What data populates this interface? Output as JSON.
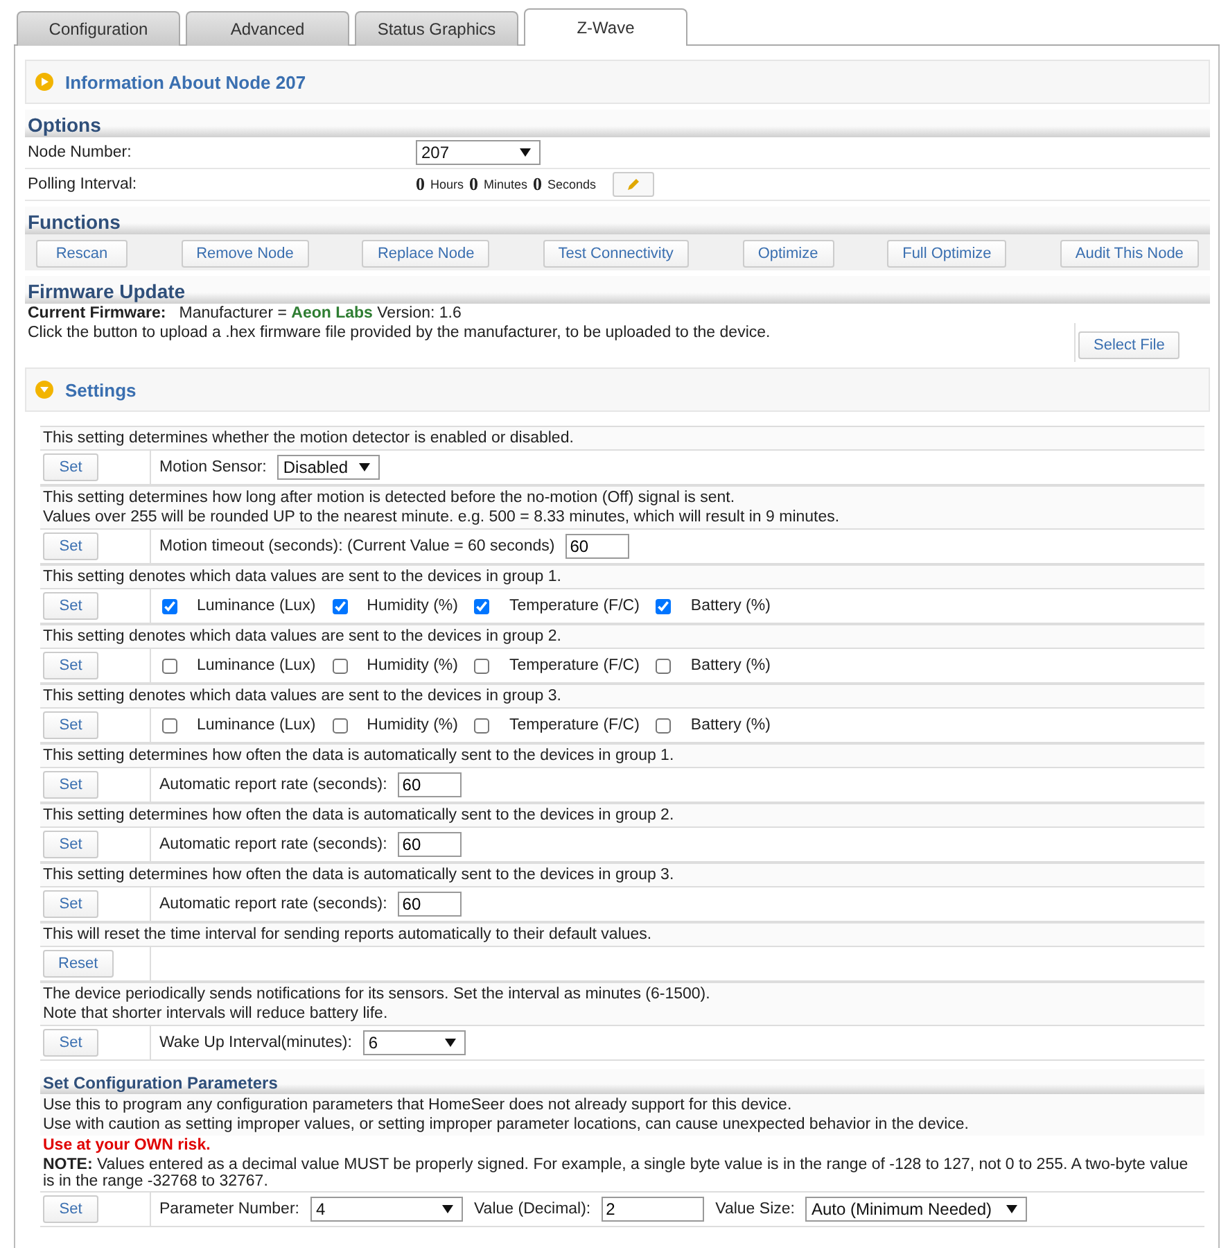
{
  "tabs": [
    {
      "label": "Configuration",
      "selected": false
    },
    {
      "label": "Advanced",
      "selected": false
    },
    {
      "label": "Status Graphics",
      "selected": false
    },
    {
      "label": "Z-Wave",
      "selected": true
    }
  ],
  "info_header": "Information About Node 207",
  "options": {
    "title": "Options",
    "node_label": "Node Number:",
    "node_value": "207",
    "polling_label": "Polling Interval:",
    "polling": [
      {
        "value": "0",
        "unit": "Hours"
      },
      {
        "value": "0",
        "unit": "Minutes"
      },
      {
        "value": "0",
        "unit": "Seconds"
      }
    ]
  },
  "functions": {
    "title": "Functions",
    "buttons": [
      "Rescan",
      "Remove Node",
      "Replace Node",
      "Test Connectivity",
      "Optimize",
      "Full Optimize",
      "Audit This Node"
    ]
  },
  "firmware": {
    "title": "Firmware Update",
    "current_label": "Current Firmware:",
    "current_text": "Manufacturer = **Aeon Labs** Version: 1.6",
    "hint": "Click the button to upload a .hex firmware file provided by the manufacturer, to be uploaded to the device.",
    "button": "Select File"
  },
  "settings": {
    "title": "Settings",
    "items": [
      {
        "description": [
          "This setting determines whether the motion detector is enabled or disabled."
        ],
        "button": "Set",
        "controls": [
          {
            "kind": "select",
            "label": "Motion Sensor:",
            "value": "Disabled"
          }
        ]
      },
      {
        "description": [
          "This setting determines how long after motion is detected before the no-motion (Off) signal is sent.",
          "Values over 255 will be rounded UP to the nearest minute. e.g. 500 = 8.33 minutes, which will result in 9 minutes."
        ],
        "button": "Set",
        "controls": [
          {
            "kind": "input",
            "label": "Motion timeout (seconds): (Current Value = 60 seconds)",
            "value": "60"
          }
        ]
      },
      {
        "description": [
          "This setting denotes which data values are sent to the devices in group 1."
        ],
        "button": "Set",
        "controls": [
          {
            "kind": "check",
            "label": "Luminance (Lux)",
            "checked": true
          },
          {
            "kind": "check",
            "label": "Humidity (%)",
            "checked": true
          },
          {
            "kind": "check",
            "label": "Temperature (F/C)",
            "checked": true
          },
          {
            "kind": "check",
            "label": "Battery (%)",
            "checked": true
          }
        ]
      },
      {
        "description": [
          "This setting denotes which data values are sent to the devices in group 2."
        ],
        "button": "Set",
        "controls": [
          {
            "kind": "check",
            "label": "Luminance (Lux)",
            "checked": false
          },
          {
            "kind": "check",
            "label": "Humidity (%)",
            "checked": false
          },
          {
            "kind": "check",
            "label": "Temperature (F/C)",
            "checked": false
          },
          {
            "kind": "check",
            "label": "Battery (%)",
            "checked": false
          }
        ]
      },
      {
        "description": [
          "This setting denotes which data values are sent to the devices in group 3."
        ],
        "button": "Set",
        "controls": [
          {
            "kind": "check",
            "label": "Luminance (Lux)",
            "checked": false
          },
          {
            "kind": "check",
            "label": "Humidity (%)",
            "checked": false
          },
          {
            "kind": "check",
            "label": "Temperature (F/C)",
            "checked": false
          },
          {
            "kind": "check",
            "label": "Battery (%)",
            "checked": false
          }
        ]
      },
      {
        "description": [
          "This setting determines how often the data is automatically sent to the devices in group 1."
        ],
        "button": "Set",
        "controls": [
          {
            "kind": "input",
            "label": "Automatic report rate (seconds):",
            "value": "60"
          }
        ]
      },
      {
        "description": [
          "This setting determines how often the data is automatically sent to the devices in group 2."
        ],
        "button": "Set",
        "controls": [
          {
            "kind": "input",
            "label": "Automatic report rate (seconds):",
            "value": "60"
          }
        ]
      },
      {
        "description": [
          "This setting determines how often the data is automatically sent to the devices in group 3."
        ],
        "button": "Set",
        "controls": [
          {
            "kind": "input",
            "label": "Automatic report rate (seconds):",
            "value": "60"
          }
        ]
      },
      {
        "description": [
          "This will reset the time interval for sending reports automatically to their default values."
        ],
        "button": "Reset"
      },
      {
        "description": [
          "The device periodically sends notifications for its sensors. Set the interval as minutes (6-1500).",
          "Note that shorter intervals will reduce battery life."
        ],
        "button": "Set",
        "controls": [
          {
            "kind": "select",
            "label": "Wake Up Interval(minutes):",
            "value": "6"
          }
        ]
      }
    ]
  },
  "config": {
    "title": "Set Configuration Parameters",
    "lines": [
      "Use this to program any configuration parameters that HomeSeer does not already support for this device.",
      "Use with caution as setting improper values, or setting improper parameter locations, can cause unexpected behavior in the device."
    ],
    "warning": "Use at your OWN risk.",
    "note": "**NOTE:** Values entered as a decimal value MUST be properly signed. For example, a single byte value is in the range of -128 to 127, not 0 to 255. A two-byte value is in the range -32768 to 32767.",
    "button": "Set",
    "controls": [
      {
        "kind": "select",
        "label": "Parameter Number:",
        "value": "4"
      },
      {
        "kind": "input",
        "label": "Value (Decimal):",
        "value": "2"
      },
      {
        "kind": "wideselect",
        "label": "Value Size:",
        "value": "Auto (Minimum Needed)"
      }
    ]
  }
}
